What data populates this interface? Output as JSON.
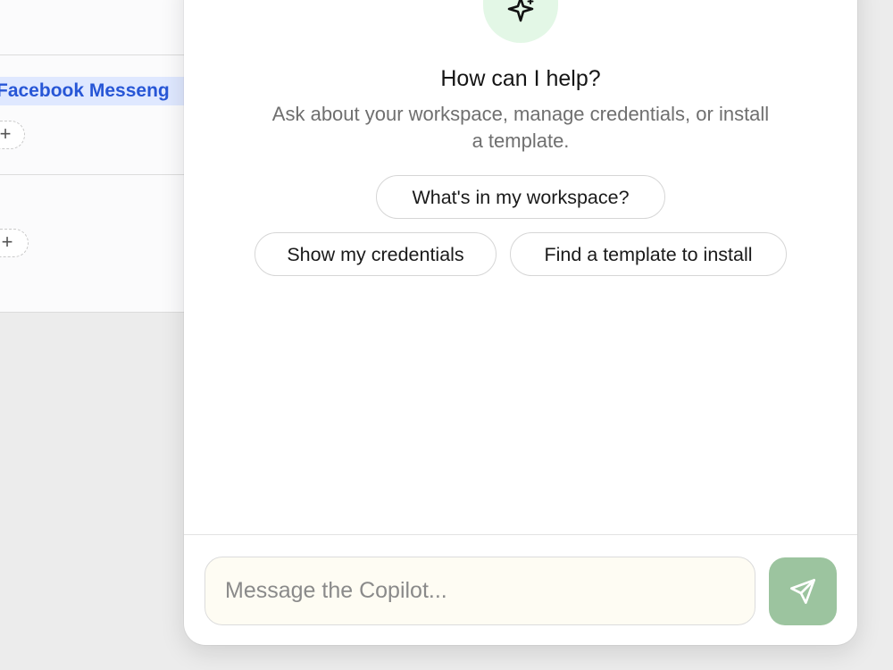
{
  "background": {
    "node_tag_label": "Facebook Messeng",
    "add_button_1": "+",
    "add_button_2": "+"
  },
  "copilot": {
    "headline": "How can I help?",
    "subtext": "Ask about your workspace, manage credentials, or install a template.",
    "suggestions": [
      "What's in my workspace?",
      "Show my credentials",
      "Find a template to install"
    ],
    "composer": {
      "placeholder": "Message the Copilot..."
    },
    "icons": {
      "logo": "sparkle-icon",
      "send": "send-icon"
    },
    "colors": {
      "accent": "#9cc49f",
      "logo_bg": "#e3f7e6",
      "tag_text": "#2756d6"
    }
  }
}
